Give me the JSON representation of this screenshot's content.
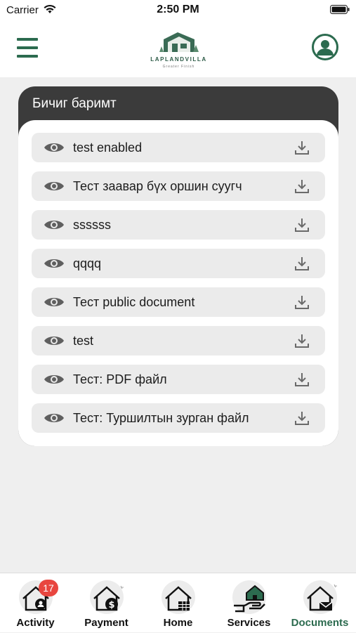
{
  "status_bar": {
    "carrier": "Carrier",
    "time": "2:50 PM"
  },
  "header": {
    "logo_text": "LAPLANDVILLA",
    "logo_subtext": "Greater Finish",
    "brand_color": "#2c6b4f"
  },
  "documents_card": {
    "title": "Бичиг баримт",
    "items": [
      {
        "name": "test enabled"
      },
      {
        "name": "Тест заавар бүх оршин суугч"
      },
      {
        "name": "ssssss"
      },
      {
        "name": "qqqq"
      },
      {
        "name": "Тест public document"
      },
      {
        "name": "test"
      },
      {
        "name": "Тест: PDF файл"
      },
      {
        "name": "Тест: Туршилтын зурган файл"
      }
    ]
  },
  "tab_bar": {
    "tabs": [
      {
        "label": "Activity",
        "icon": "activity-house-icon",
        "badge": "17",
        "active": false
      },
      {
        "label": "Payment",
        "icon": "payment-house-icon",
        "active": false
      },
      {
        "label": "Home",
        "icon": "home-house-icon",
        "active": false
      },
      {
        "label": "Services",
        "icon": "services-hand-house-icon",
        "active": false
      },
      {
        "label": "Documents",
        "icon": "documents-house-icon",
        "active": true
      }
    ],
    "active_color": "#2c6b4f",
    "badge_color": "#e8463f"
  }
}
